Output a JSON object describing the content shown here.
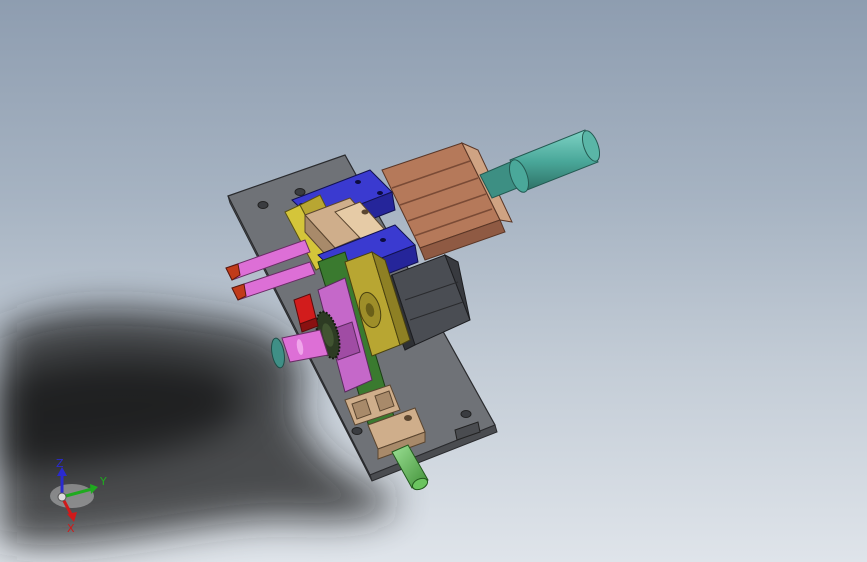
{
  "view": {
    "background_top": "#8e9db0",
    "background_bottom": "#dfe4ea"
  },
  "triad": {
    "z_label": "Z",
    "y_label": "Y",
    "x_label": "X",
    "z_color": "#2a2ad0",
    "y_color": "#1faa1f",
    "x_color": "#d01a1a"
  },
  "model": {
    "colors": {
      "base_plate": "#6f7277",
      "cylinder_barrel": "#b5795a",
      "clamp_block": "#3a3ad0",
      "shaft": "#4aa89a",
      "slider": "#cfae8b",
      "yellow_plate": "#b8a632",
      "magenta_plate": "#c568c9",
      "green_plate": "#3a7a2f",
      "motor": "#4a4d53",
      "gear": "#2d3b23",
      "red_block": "#d21c1c",
      "pink_rod": "#dd6fd6"
    }
  }
}
